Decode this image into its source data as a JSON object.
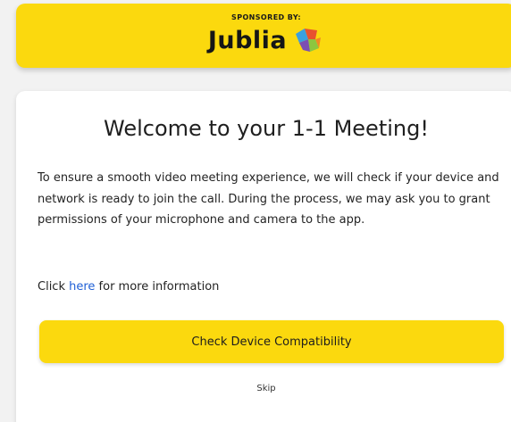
{
  "sponsor": {
    "caption": "SPONSORED BY:",
    "brand": "Jublia",
    "logo_icon": "jublia-logo-icon",
    "banner_color": "#fbd90e"
  },
  "welcome": {
    "title": "Welcome to your 1-1 Meeting!",
    "body": "To ensure a smooth video meeting experience, we will check if your device and network is ready to join the call. During the process, we may ask you to grant permissions of your microphone and camera to the app.",
    "info_prefix": "Click ",
    "info_link": "here",
    "info_suffix": " for more information",
    "link_color": "#1f5fd6"
  },
  "actions": {
    "check_label": "Check Device Compatibility",
    "skip_label": "Skip",
    "button_color": "#fbd90e"
  }
}
